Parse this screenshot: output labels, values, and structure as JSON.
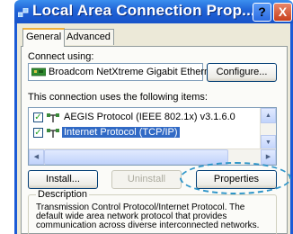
{
  "window": {
    "title": "Local Area Connection Prop...",
    "help_label": "?",
    "close_label": "X"
  },
  "tabs": [
    {
      "label": "General",
      "active": true
    },
    {
      "label": "Advanced",
      "active": false
    }
  ],
  "connect_using": {
    "label": "Connect using:",
    "adapter": "Broadcom NetXtreme Gigabit Etherne",
    "configure_label": "Configure..."
  },
  "items_section": {
    "label": "This connection uses the following items:",
    "items": [
      {
        "label": "AEGIS Protocol (IEEE 802.1x) v3.1.6.0",
        "checked": true,
        "selected": false
      },
      {
        "label": "Internet Protocol (TCP/IP)",
        "checked": true,
        "selected": true
      }
    ]
  },
  "buttons": {
    "install": "Install...",
    "uninstall": "Uninstall",
    "properties": "Properties"
  },
  "description": {
    "title": "Description",
    "text": "Transmission Control Protocol/Internet Protocol. The default wide area network protocol that provides communication across diverse interconnected networks."
  },
  "colors": {
    "titlebar": "#1f62d6",
    "selection": "#316ac5",
    "highlight_ellipse": "#2e95c8"
  }
}
